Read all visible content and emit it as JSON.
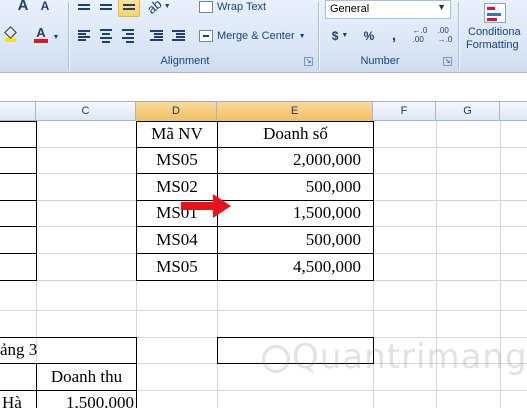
{
  "ribbon": {
    "font_group": {
      "increase_font_glyph": "A",
      "decrease_font_glyph": "A",
      "font_color_glyph": "A"
    },
    "alignment": {
      "wrap_text": "Wrap Text",
      "merge_center": "Merge & Center",
      "label": "Alignment"
    },
    "number": {
      "format_value": "General",
      "currency": "$",
      "percent": "%",
      "comma": ",",
      "increase_decimal": "←.0\n.00",
      "decrease_decimal": ".00\n→.0",
      "label": "Number"
    },
    "styles": {
      "conditional_line1": "Conditiona",
      "conditional_line2": "Formatting"
    }
  },
  "columns": [
    "C",
    "D",
    "E",
    "F",
    "G"
  ],
  "table1": {
    "header_id": "Mã NV",
    "header_sales": "Doanh số",
    "rows": [
      {
        "id": "MS05",
        "sales": "2,000,000"
      },
      {
        "id": "MS02",
        "sales": "500,000"
      },
      {
        "id": "MS01",
        "sales": "1,500,000"
      },
      {
        "id": "MS04",
        "sales": "500,000"
      },
      {
        "id": "MS05",
        "sales": "4,500,000"
      }
    ]
  },
  "table2": {
    "title_partial": "ảng 3",
    "header_revenue": "Doanh thu",
    "row1_partial_name": "Hà",
    "row1_revenue": "1,500,000"
  },
  "watermark": {
    "text": "Quantrimang"
  },
  "colors": {
    "arrow": "#e8141b",
    "accent": "#15428b"
  }
}
